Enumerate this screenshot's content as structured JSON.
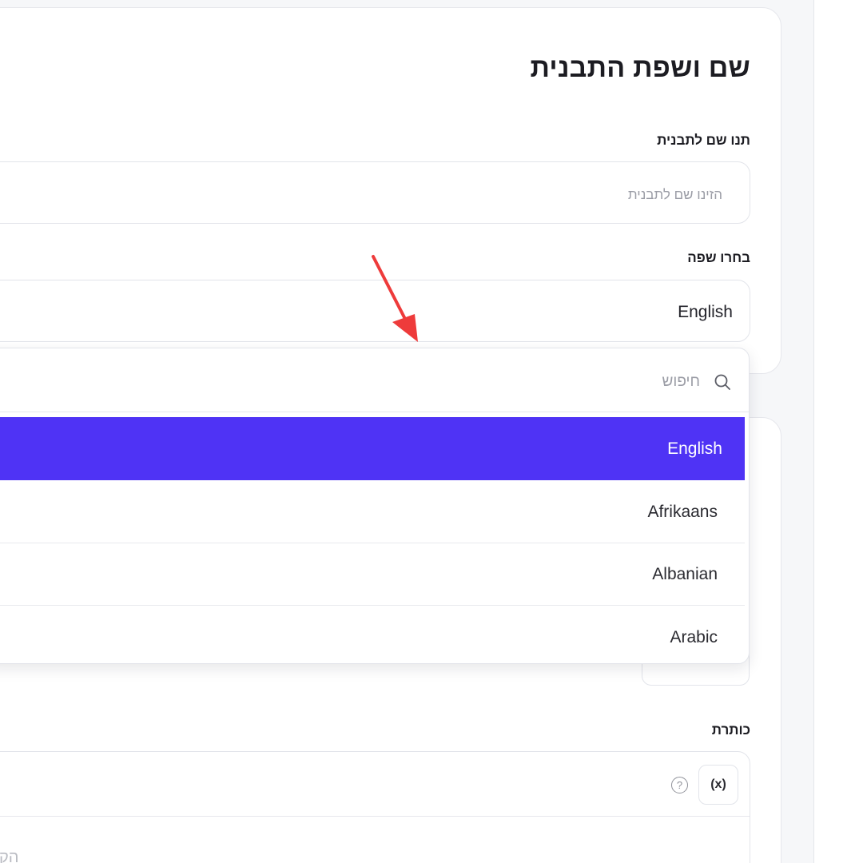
{
  "card": {
    "title": "שם ושפת התבנית"
  },
  "name_field": {
    "label": "תנו שם לתבנית",
    "placeholder": "הזינו שם לתבנית"
  },
  "language_field": {
    "label": "בחרו שפה",
    "selected_value": "English"
  },
  "dropdown": {
    "search_placeholder": "חיפוש",
    "options": [
      "English",
      "Afrikaans",
      "Albanian",
      "Arabic"
    ],
    "selected_index": 0
  },
  "title_field": {
    "label": "כותרת",
    "variable_button": "(x)",
    "help_glyph": "?",
    "hint_fragment": "הק"
  },
  "colors": {
    "selected_option_bg": "#4f33f5",
    "annotation_arrow": "#ee3b3b"
  },
  "icons": {
    "search": "search-icon",
    "help": "help-circle-icon",
    "variable": "variable-icon"
  }
}
